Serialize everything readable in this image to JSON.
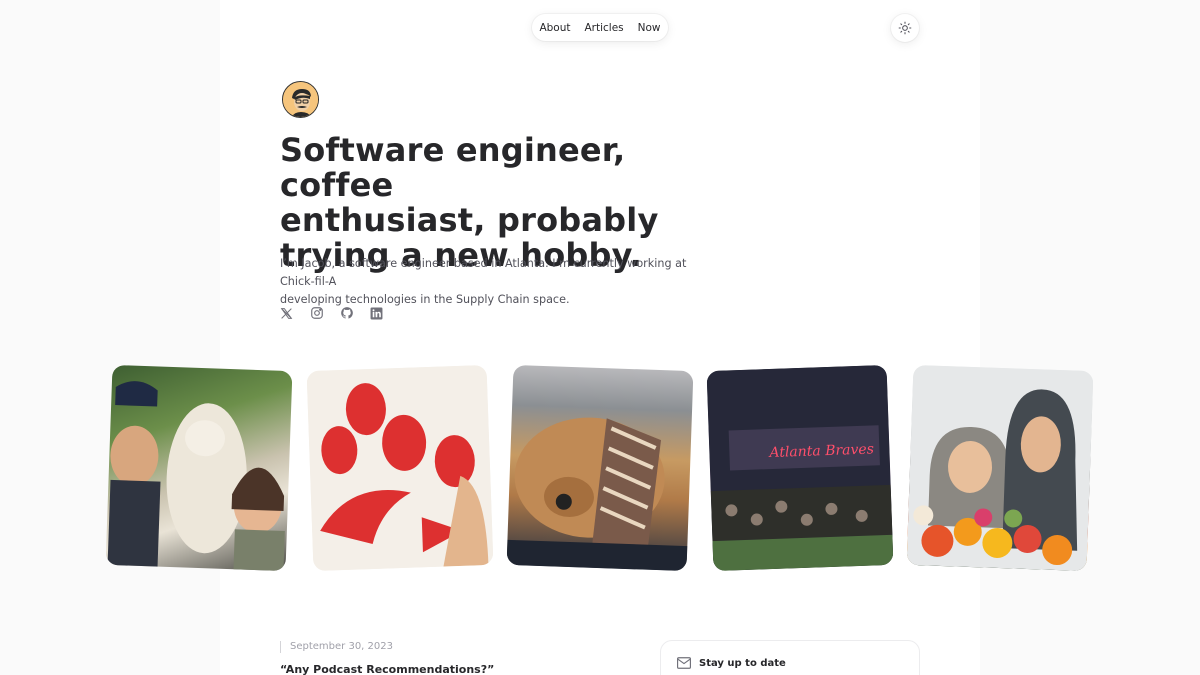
{
  "nav": {
    "items": [
      {
        "label": "About"
      },
      {
        "label": "Articles"
      },
      {
        "label": "Now"
      }
    ]
  },
  "theme_toggle": {
    "icon": "sun-icon"
  },
  "hero": {
    "headline_lines": [
      "Software engineer, coffee",
      "enthusiast, probably",
      "trying a new hobby."
    ],
    "intro_lines": [
      "I’m Jacob, a software engineer based in Atlanta. I’m currently working at Chick-fil-A",
      "developing technologies in the Supply Chain space."
    ],
    "socials": [
      {
        "icon": "x-icon"
      },
      {
        "icon": "instagram-icon"
      },
      {
        "icon": "github-icon"
      },
      {
        "icon": "linkedin-icon"
      }
    ]
  },
  "photos": [
    {
      "subject": "selfie-with-llama"
    },
    {
      "subject": "chick-fil-a-bag"
    },
    {
      "subject": "sleeping-dog"
    },
    {
      "subject": "atlanta-braves-stadium"
    },
    {
      "subject": "couple-with-flowers"
    }
  ],
  "article": {
    "date": "September 30, 2023",
    "title": "“Any Podcast Recommendations?”"
  },
  "newsletter": {
    "title": "Stay up to date",
    "icon": "mail-icon"
  },
  "colors": {
    "background": "#fafafa",
    "panel": "#ffffff",
    "text": "#27272a",
    "muted": "#52525b",
    "brand_red": "#dd3030"
  }
}
